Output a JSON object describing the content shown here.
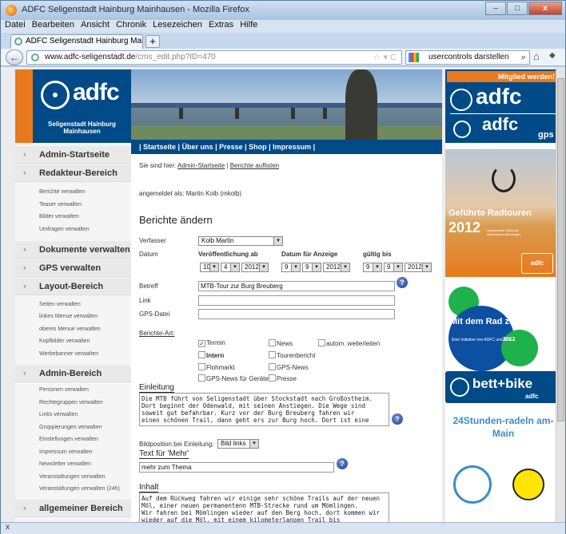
{
  "window": {
    "title": "ADFC Seligenstadt Hainburg Mainhausen - Mozilla Firefox",
    "min": "–",
    "max": "□",
    "close": "x"
  },
  "menu": [
    "Datei",
    "Bearbeiten",
    "Ansicht",
    "Chronik",
    "Lesezeichen",
    "Extras",
    "Hilfe"
  ],
  "tab": {
    "label": "ADFC Seligenstadt Hainburg Mainhausen",
    "new": "+"
  },
  "nav": {
    "url_host": "www.adfc-seligenstadt.de",
    "url_path": "/cms_edit.php?ID=470",
    "url_prefix": "",
    "search_text": "usercontrols darstellen"
  },
  "status": {
    "text": "x"
  },
  "logo": {
    "brand": "adfc",
    "subtitle": "Seligenstadt Hainburg Mainhausen"
  },
  "sidebar": {
    "sections": [
      {
        "label": "Admin-Startseite"
      },
      {
        "label": "Redakteur-Bereich"
      },
      {
        "label": "Dokumente verwalten"
      },
      {
        "label": "GPS verwalten"
      },
      {
        "label": "Layout-Bereich"
      },
      {
        "label": "Admin-Bereich"
      },
      {
        "label": "allgemeiner Bereich"
      }
    ],
    "redakteur_items": [
      "Berichte verwalten",
      "Teaser verwalten",
      "Bilder verwalten",
      "Umfragen verwalten"
    ],
    "layout_items": [
      "Seiten verwalten",
      "linkes Menue verwalten",
      "oberes Menue verwalten",
      "Kopfbilder verwalten",
      "Werbebanner verwalten"
    ],
    "admin_items": [
      "Personen verwalten",
      "Rechtegruppen verwalten",
      "Links verwalten",
      "Gruppierungen verwalten",
      "Einstellungen verwalten",
      "Impressum verwalten",
      "Newsletter verwalten",
      "Veranstaltungen verwalten",
      "Veranstaltungen verwalten (24h)"
    ],
    "arrow": "›"
  },
  "topnav": "|  Startseite  |  Über uns  |  Presse  |  Shop  |  Impressum  |",
  "breadcrumb": {
    "prefix": "Sie sind hier:",
    "link1": "Admin-Startseite",
    "sep": "|",
    "link2": "Berichte auflisten"
  },
  "loggedin": "angemeldet als: Martin Kolb (mkolb)",
  "form": {
    "heading": "Berichte ändern",
    "verfasser_label": "Verfasser",
    "verfasser_value": "Kolb Martin",
    "datum_label": "Datum",
    "veroeff_label": "Veröffentlichung ab",
    "anzeige_label": "Datum für Anzeige",
    "gueltig_label": "gültig bis",
    "date1": {
      "d": "10",
      "m": "4",
      "y": "2012"
    },
    "date2": {
      "d": "9",
      "m": "9",
      "y": "2012"
    },
    "date3": {
      "d": "9",
      "m": "9",
      "y": "2012"
    },
    "betreff_label": "Betreff",
    "betreff_value": "MTB-Tour zur Burg Breuberg",
    "link_label": "Link",
    "gps_label": "GPS-Datei",
    "art_label": "Berichte-Art:",
    "checks": {
      "termin": "Termin",
      "news": "News",
      "autom": "autom. weiterleiten",
      "intern": "Intern",
      "tourenbericht": "Tourenbericht",
      "flohmarkt": "Flohmarkt",
      "gpsnews": "GPS-News",
      "gpsgeraete": "GPS-News für Geräte",
      "presse": "Presse",
      "checkmark": "✓"
    },
    "einleitung_label": "Einleitung",
    "einleitung_text": "Die MTB führt von Seligenstadt über Stockstadt nach Großostheim.\nDort beginnt der Odenwald, mit seinen Anstiegen. Die Wege sind\nsoweit gut befahrbar. Kurz vor der Burg Breuberg fahren wir\neinen schönen Trail, dann geht ers zur Burg hoch. Dort ist eine",
    "bildpos_label": "Bildposition bei Einleitung:",
    "bildpos_value": "Bild links",
    "mehr_label": "Text für 'Mehr'",
    "mehr_value": "mehr zum Thema",
    "inhalt_label": "Inhalt",
    "inhalt_text": "Auf dem Rückweg fahren wir einige sehr schöne Trails auf der neuen\nMöl, einer neuen permanentenn MTB-Strecke rund um Mömlingen.\nWir fahren bei Mömlingen wieder auf den Berg hoch, dort kommen wir\nwieder auf die Möl, mit einem kilometerlangen Trail bis",
    "help": "?"
  },
  "ads": {
    "mitglied": "Mitglied werden!",
    "adfc": "adfc",
    "gps": "gps",
    "radtouren_title": "Geführte Radtouren",
    "radtouren_year": "2012",
    "radtouren_small": "Seligenstadt Hainburg Mainhausen Mömlingen",
    "radtouren_logo": "adfc",
    "arbeit_title": "Mit dem Rad zur Arbeit",
    "arbeit_sub": "Eine Initiative von ADFC und AOK",
    "arbeit_year": "2012",
    "bettbike": "bett+bike",
    "bettbike_sub": "adfc",
    "stunden": "24Stunden-radeln am-Main"
  }
}
